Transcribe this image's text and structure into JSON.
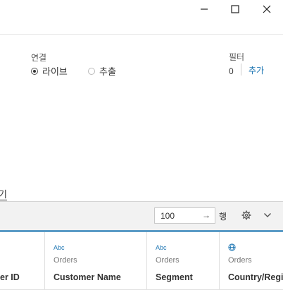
{
  "window": {
    "controls": [
      "minimize",
      "maximize",
      "close"
    ]
  },
  "connection": {
    "label": "연결",
    "options": [
      {
        "label": "라이브",
        "selected": true
      },
      {
        "label": "추출",
        "selected": false
      }
    ]
  },
  "filters": {
    "label": "필터",
    "count": "0",
    "add_label": "추가"
  },
  "sheet_tab": {
    "label": "기"
  },
  "toolbar": {
    "rows_value": "100",
    "rows_arrow": "→",
    "rows_label": "행"
  },
  "grid": {
    "columns": [
      {
        "type": "",
        "source": "",
        "name": "er ID"
      },
      {
        "type": "Abc",
        "source": "Orders",
        "name": "Customer Name"
      },
      {
        "type": "Abc",
        "source": "Orders",
        "name": "Segment"
      },
      {
        "type": "globe-icon",
        "source": "Orders",
        "name": "Country/Regi"
      }
    ]
  },
  "colors": {
    "accent": "#5b9bc6",
    "link": "#1f77b4",
    "toolbar_bg": "#f2f2f2"
  }
}
